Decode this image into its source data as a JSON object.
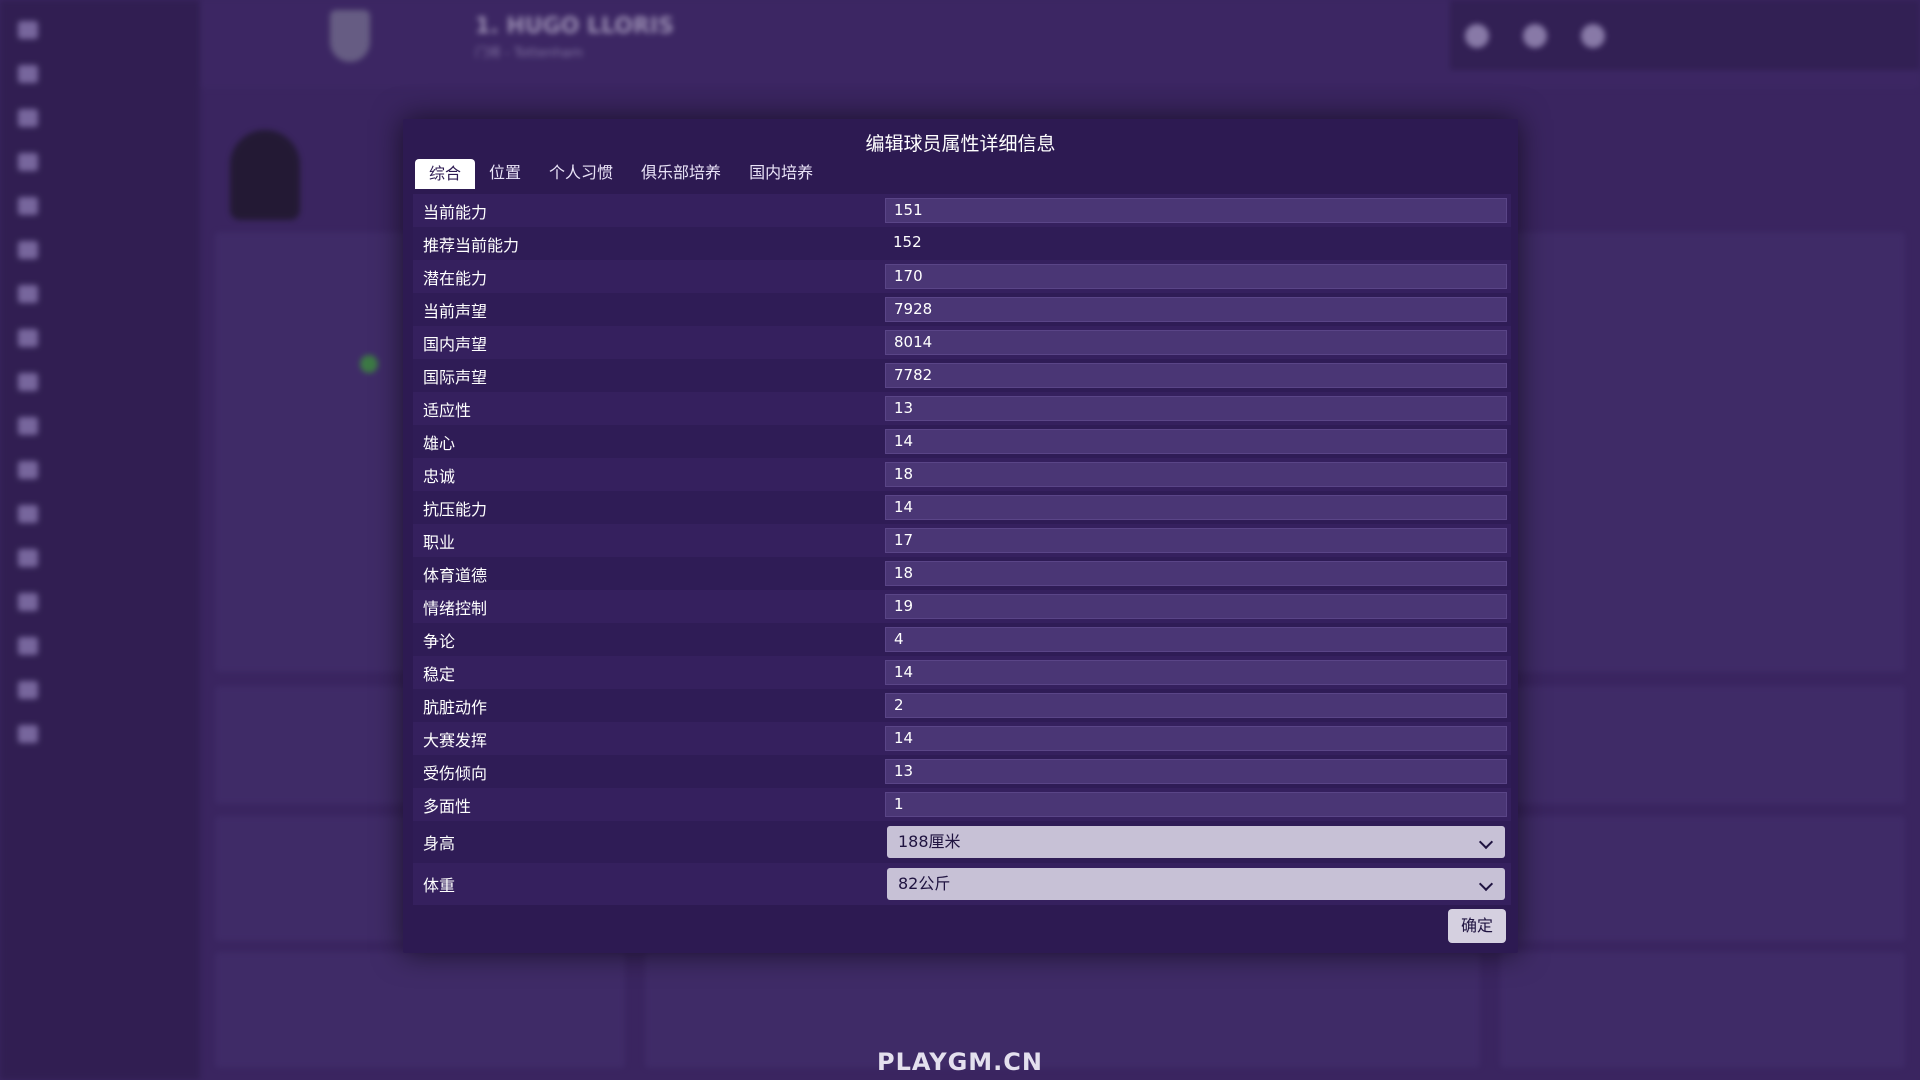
{
  "background": {
    "player_name": "1. HUGO LLORIS",
    "player_sub": "门将 - Tottenham",
    "watermark": "PLAYGM.CN"
  },
  "dialog": {
    "title": "编辑球员属性详细信息",
    "tabs": [
      {
        "label": "综合",
        "active": true
      },
      {
        "label": "位置",
        "active": false
      },
      {
        "label": "个人习惯",
        "active": false
      },
      {
        "label": "俱乐部培养",
        "active": false
      },
      {
        "label": "国内培养",
        "active": false
      }
    ],
    "rows": [
      {
        "label": "当前能力",
        "value": "151"
      },
      {
        "label": "推荐当前能力",
        "value": "152"
      },
      {
        "label": "潜在能力",
        "value": "170"
      },
      {
        "label": "当前声望",
        "value": "7928"
      },
      {
        "label": "国内声望",
        "value": "8014"
      },
      {
        "label": "国际声望",
        "value": "7782"
      },
      {
        "label": "适应性",
        "value": "13"
      },
      {
        "label": "雄心",
        "value": "14"
      },
      {
        "label": "忠诚",
        "value": "18"
      },
      {
        "label": "抗压能力",
        "value": "14"
      },
      {
        "label": "职业",
        "value": "17"
      },
      {
        "label": "体育道德",
        "value": "18"
      },
      {
        "label": "情绪控制",
        "value": "19"
      },
      {
        "label": "争论",
        "value": "4"
      },
      {
        "label": "稳定",
        "value": "14"
      },
      {
        "label": "肮脏动作",
        "value": "2"
      },
      {
        "label": "大赛发挥",
        "value": "14"
      },
      {
        "label": "受伤倾向",
        "value": "13"
      },
      {
        "label": "多面性",
        "value": "1"
      }
    ],
    "selects": [
      {
        "label": "身高",
        "value": "188厘米"
      },
      {
        "label": "体重",
        "value": "82公斤"
      }
    ],
    "confirm_label": "确定"
  },
  "colors": {
    "dialog_bg": "#2d1a52",
    "field_bg": "#4a3675",
    "select_bg": "#c7c1d6"
  }
}
